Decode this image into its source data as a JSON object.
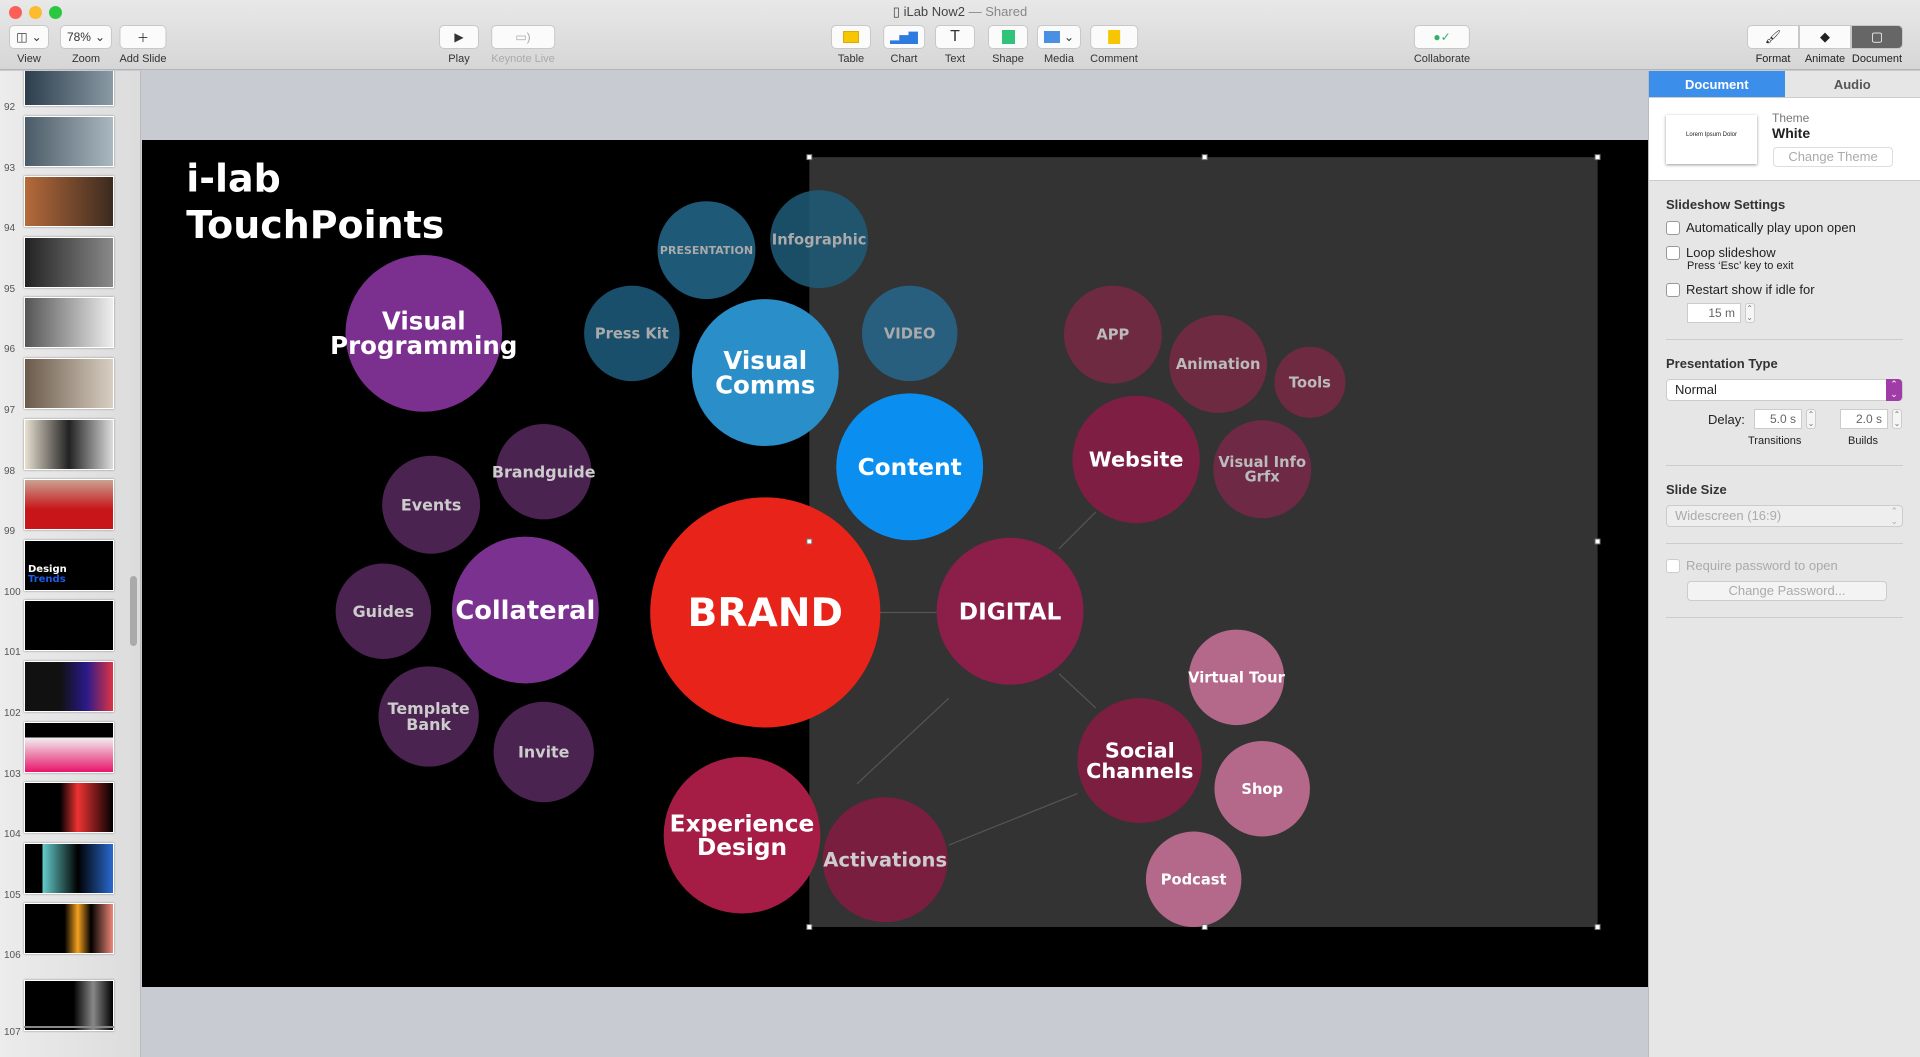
{
  "window": {
    "title": "iLab Now2",
    "shared": "— Shared"
  },
  "toolbar": {
    "view": "View",
    "zoom": "Zoom",
    "zoom_value": "78%",
    "add_slide": "Add Slide",
    "play": "Play",
    "keynote_live": "Keynote Live",
    "table": "Table",
    "chart": "Chart",
    "text": "Text",
    "shape": "Shape",
    "media": "Media",
    "comment": "Comment",
    "collaborate": "Collaborate",
    "format": "Format",
    "animate": "Animate",
    "document": "Document"
  },
  "sidebar": {
    "slides": [
      "92",
      "93",
      "94",
      "95",
      "96",
      "97",
      "98",
      "99",
      "100",
      "101",
      "102",
      "103",
      "104",
      "105",
      "106",
      "107"
    ],
    "slide100_title": "Design",
    "slide100_sub": "Trends"
  },
  "slide": {
    "title_line1": "i-lab",
    "title_line2": "TouchPoints",
    "bubbles": {
      "visual_programming": [
        "Visual",
        "Programming"
      ],
      "events": "Events",
      "brandguide": "Brandguide",
      "guides": "Guides",
      "collateral": "Collateral",
      "template_bank": [
        "Template",
        "Bank"
      ],
      "invite": "Invite",
      "press_kit": "Press Kit",
      "presentation": "PRESENTATION",
      "infographic": "Infographic",
      "visual_comms": [
        "Visual",
        "Comms"
      ],
      "video": "VIDEO",
      "content": "Content",
      "brand": "BRAND",
      "digital": "DIGITAL",
      "experience_design": [
        "Experience",
        "Design"
      ],
      "activations": "Activations",
      "app": "APP",
      "animation": "Animation",
      "tools": "Tools",
      "website": "Website",
      "visual_info": [
        "Visual Info",
        "Grfx"
      ],
      "virtual_tour": "Virtual Tour",
      "social_channels": [
        "Social",
        "Channels"
      ],
      "shop": "Shop",
      "podcast": "Podcast"
    },
    "colors": {
      "brand": "#e8231a",
      "content": "#0a8ff0",
      "visual_comms": "#2a8ec8",
      "purple": "#7b2f8e",
      "digital": "#8c1e4a"
    }
  },
  "inspector": {
    "tabs": [
      "Document",
      "Audio"
    ],
    "theme_label": "Theme",
    "theme_name": "White",
    "change_theme": "Change Theme",
    "thumb_text": "Lorem Ipsum Dolor",
    "slideshow_settings": "Slideshow Settings",
    "auto_play": "Automatically play upon open",
    "loop": "Loop slideshow",
    "loop_hint": "Press ‘Esc’ key to exit",
    "restart": "Restart show if idle for",
    "idle_value": "15 m",
    "presentation_type": "Presentation Type",
    "type_value": "Normal",
    "delay": "Delay:",
    "transitions_value": "5.0 s",
    "builds_value": "2.0 s",
    "transitions": "Transitions",
    "builds": "Builds",
    "slide_size": "Slide Size",
    "size_value": "Widescreen (16:9)",
    "require_password": "Require password to open",
    "change_password": "Change Password..."
  }
}
